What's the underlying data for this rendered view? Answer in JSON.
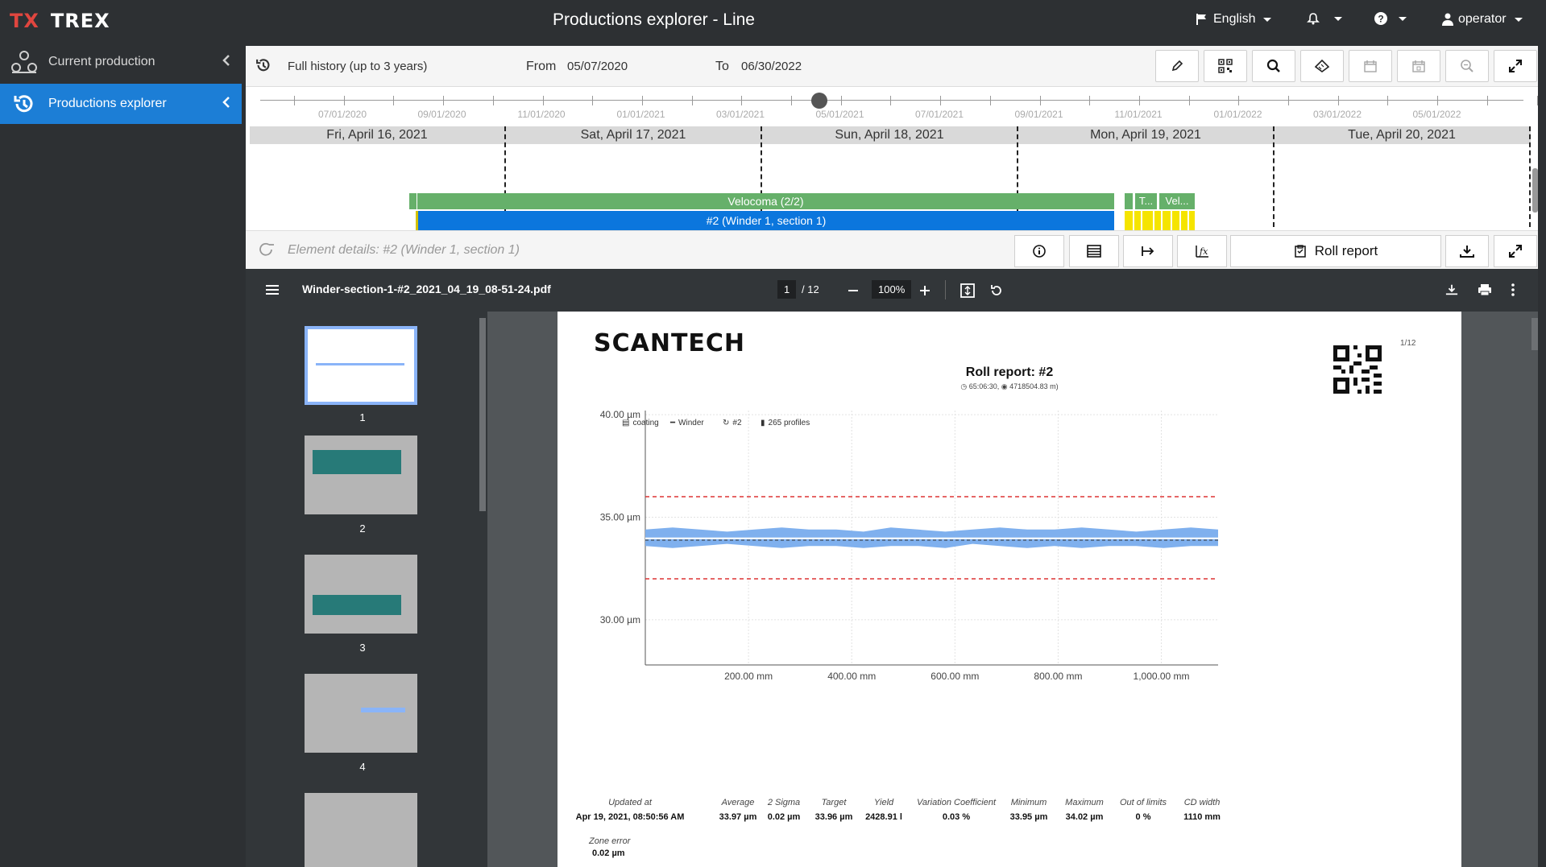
{
  "app": {
    "logo_tx": "TX",
    "logo_name": "TREX",
    "title": "Productions explorer - Line",
    "language": "English",
    "user": "operator"
  },
  "sidebar": {
    "items": [
      {
        "label": "Current production",
        "icon": "production-line-icon",
        "active": false
      },
      {
        "label": "Productions explorer",
        "icon": "history-icon",
        "active": true
      }
    ]
  },
  "history": {
    "range_label": "Full history (up to 3 years)",
    "from_label": "From",
    "from_value": "05/07/2020",
    "to_label": "To",
    "to_value": "06/30/2022",
    "toolbar_icons": [
      "pencil-icon",
      "qr-code-icon",
      "search-icon",
      "tape-measure-icon",
      "calendar-icon",
      "calendar-day-icon",
      "zoom-out-icon",
      "expand-icon"
    ]
  },
  "timeline": {
    "ticks": [
      "07/01/2020",
      "09/01/2020",
      "11/01/2020",
      "01/01/2021",
      "03/01/2021",
      "05/01/2021",
      "07/01/2021",
      "09/01/2021",
      "11/01/2021",
      "01/01/2022",
      "03/01/2022",
      "05/01/2022"
    ],
    "days": [
      "Fri, April 16, 2021",
      "Sat, April 17, 2021",
      "Sun, April 18, 2021",
      "Mon, April 19, 2021",
      "Tue, April 20, 2021"
    ]
  },
  "gantt": {
    "production_bar": "Velocoma (2/2)",
    "roll_bar": "#2 (Winder 1, section 1)",
    "small_bar_1": "T...",
    "small_bar_2": "Vel...",
    "colors": {
      "production": "#66b06a",
      "roll": "#0b76dd",
      "other": "#f5e400"
    }
  },
  "details": {
    "label": "Element details: #2 (Winder 1, section 1)",
    "roll_report_label": "Roll report"
  },
  "pdf": {
    "filename": "Winder-section-1-#2_2021_04_19_08-51-24.pdf",
    "page": "1",
    "page_total": "/ 12",
    "zoom": "100%",
    "thumb_numbers": [
      "1",
      "2",
      "3",
      "4"
    ]
  },
  "report": {
    "brand": "SCANTECH",
    "title": "Roll report: #2",
    "subtitle_duration": "65:06:30,",
    "subtitle_length": "4718504.83 m)",
    "page_indicator": "1/12",
    "legend": {
      "coating": "coating",
      "winder": "Winder",
      "roll": "#2",
      "profiles": "265 profiles"
    },
    "stats": [
      {
        "label": "Updated at",
        "value": "Apr 19, 2021, 08:50:56 AM"
      },
      {
        "label": "Average",
        "value": "33.97 µm"
      },
      {
        "label": "2 Sigma",
        "value": "0.02 µm"
      },
      {
        "label": "Target",
        "value": "33.96 µm"
      },
      {
        "label": "Yield",
        "value": "2428.91 l"
      },
      {
        "label": "Variation Coefficient",
        "value": "0.03 %"
      },
      {
        "label": "Minimum",
        "value": "33.95 µm"
      },
      {
        "label": "Maximum",
        "value": "34.02 µm"
      },
      {
        "label": "Out of limits",
        "value": "0 %"
      },
      {
        "label": "CD width",
        "value": "1110 mm"
      }
    ],
    "zone_error_label": "Zone error",
    "zone_error_value": "0.02 µm"
  },
  "chart_data": {
    "type": "area",
    "x_ticks": [
      "200.00 mm",
      "400.00 mm",
      "600.00 mm",
      "800.00 mm",
      "1,000.00 mm"
    ],
    "y_ticks": [
      "40.00 µm",
      "35.00 µm",
      "30.00 µm"
    ],
    "xlim": [
      0,
      1110
    ],
    "ylim": [
      27.8,
      40.2
    ],
    "limits": {
      "upper": 36.0,
      "lower": 32.0
    },
    "band_upper": [
      34.4,
      34.5,
      34.4,
      34.3,
      34.4,
      34.5,
      34.4,
      34.4,
      34.3,
      34.5,
      34.4,
      34.3,
      34.4,
      34.5,
      34.4,
      34.4,
      34.5,
      34.4,
      34.3,
      34.4,
      34.5,
      34.4
    ],
    "band_lower": [
      33.6,
      33.5,
      33.6,
      33.7,
      33.6,
      33.5,
      33.6,
      33.6,
      33.5,
      33.6,
      33.6,
      33.5,
      33.7,
      33.6,
      33.5,
      33.6,
      33.5,
      33.6,
      33.6,
      33.5,
      33.6,
      33.6
    ],
    "average": 33.97,
    "target": 33.96,
    "colors": {
      "band": "#7fb0ee",
      "limit": "#d33",
      "avg": "#ffffff",
      "target": "#333333"
    }
  }
}
